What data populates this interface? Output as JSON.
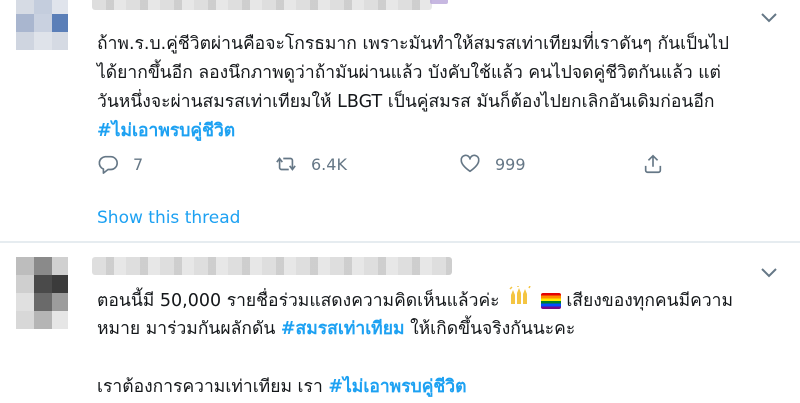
{
  "tweets": [
    {
      "text_lines": [
        "ถ้าพ.ร.บ.คู่ชีวิตผ่านคือจะโกรธมาก เพราะมันทำให้สมรสเท่าเทียมที่เราดันๆ กันเป็นไป",
        "ได้ยากขึ้นอีก ลองนึกภาพดูว่าถ้ามันผ่านแล้ว บังคับใช้แล้ว คนไปจดคู่ชีวิตกันแล้ว แต่",
        "วันหนึ่งจะผ่านสมรสเท่าเทียมให้ LBGT เป็นคู่สมรส มันก็ต้องไปยกเลิกอันเดิมก่อนอีก"
      ],
      "hashtag": "#ไม่เอาพรบคู่ชีวิต",
      "actions": {
        "reply_count": "7",
        "retweet_count": "6.4K",
        "like_count": "999"
      },
      "show_thread": "Show this thread"
    },
    {
      "line1_a": "ตอนนี้มี 50,000 รายชื่อร่วมแสดงความคิดเห็นแล้วค่ะ",
      "line1_b": "เสียงของทุกคนมีความ",
      "line2_a": "หมาย มาร่วมกันผลักดัน",
      "line2_hashtag": "#สมรสเท่าเทียม",
      "line2_b": "ให้เกิดขึ้นจริงกันนะคะ",
      "line3_a": "เราต้องการความเท่าเทียม เรา",
      "line3_hashtag": "#ไม่เอาพรบคู่ชีวิต"
    }
  ],
  "colors": {
    "accent": "#1da1f2",
    "muted": "#657786",
    "text": "#14171a",
    "divider": "#e6ecf0"
  },
  "icons": [
    "reply-icon",
    "retweet-icon",
    "like-icon",
    "share-icon",
    "chevron-down-icon",
    "raising-hands-emoji",
    "rainbow-flag-emoji"
  ]
}
